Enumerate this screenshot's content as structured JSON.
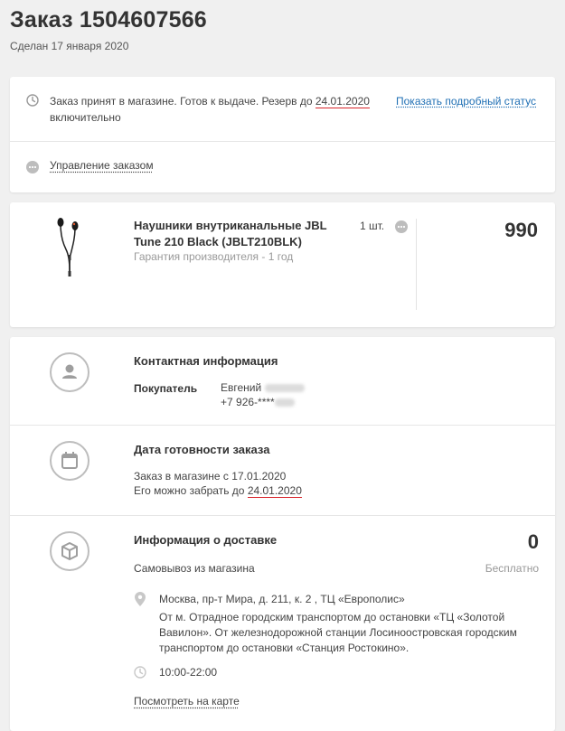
{
  "order": {
    "title": "Заказ 1504607566",
    "date": "Сделан 17 января 2020"
  },
  "status": {
    "text_before": "Заказ принят в магазине. Готов к выдаче. Резерв до ",
    "reserve_date": "24.01.2020",
    "text_after": " включительно",
    "details_link": "Показать подробный статус",
    "manage_label": "Управление заказом"
  },
  "product": {
    "name": "Наушники внутриканальные JBL Tune 210 Black (JBLT210BLK)",
    "warranty": "Гарантия производителя - 1 год",
    "quantity": "1 шт.",
    "price": "990"
  },
  "contact": {
    "title": "Контактная информация",
    "buyer_label": "Покупатель",
    "buyer_name": "Евгений",
    "buyer_phone": "+7 926-****"
  },
  "readiness": {
    "title": "Дата готовности заказа",
    "in_store_text": "Заказ в магазине с 17.01.2020",
    "pickup_text": "Его можно забрать до ",
    "pickup_date": "24.01.2020"
  },
  "delivery": {
    "title": "Информация о доставке",
    "method": "Самовывоз из магазина",
    "price": "0",
    "price_note": "Бесплатно",
    "address": "Москва, пр-т Мира, д. 211, к. 2 , ТЦ «Европолис»",
    "directions": "От м. Отрадное городским транспортом до остановки «ТЦ «Золотой Вавилон». От железнодорожной станции Лосиноостровская городским транспортом до остановки «Станция Ростокино».",
    "hours": "10:00-22:00",
    "map_link": "Посмотреть на карте"
  },
  "colors": {
    "accent_red": "#d9252b",
    "link_blue": "#1f6fb4",
    "icon_gray": "#bdbdbd"
  }
}
